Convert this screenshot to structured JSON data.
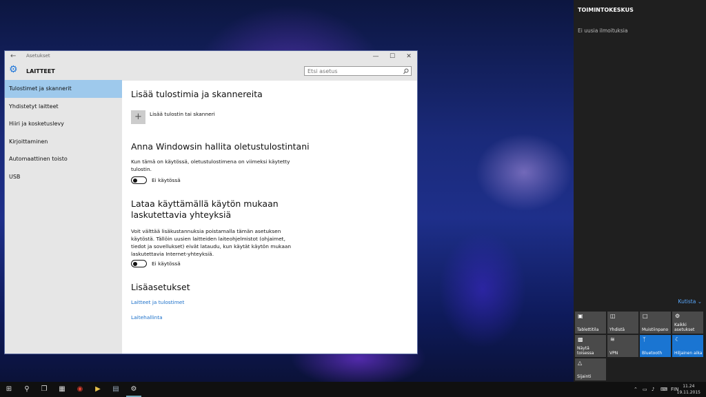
{
  "window": {
    "title": "Asetukset",
    "back_icon": "back-arrow-icon",
    "minimize": "—",
    "maximize": "☐",
    "close": "✕",
    "section_title": "LAITTEET",
    "search_placeholder": "Etsi asetus"
  },
  "sidebar": {
    "items": [
      {
        "label": "Tulostimet ja skannerit",
        "active": true
      },
      {
        "label": "Yhdistetyt laitteet"
      },
      {
        "label": "Hiiri ja kosketuslevy"
      },
      {
        "label": "Kirjoittaminen"
      },
      {
        "label": "Automaattinen toisto"
      },
      {
        "label": "USB"
      }
    ]
  },
  "content": {
    "add_heading": "Lisää tulostimia ja skannereita",
    "add_button": "Lisää tulostin tai skanneri",
    "default_heading": "Anna Windowsin hallita oletustulostintani",
    "default_desc": "Kun tämä on käytössä, oletustulostimena on viimeksi käytetty tulostin.",
    "default_toggle": "Ei käytössä",
    "metered_heading": "Lataa käyttämällä käytön mukaan laskutettavia yhteyksiä",
    "metered_desc": "Voit välttää lisäkustannuksia poistamalla tämän asetuksen käytöstä. Tällöin uusien laitteiden laiteohjelmistot (ohjaimet, tiedot ja sovellukset) eivät lataudu, kun käytät käytön mukaan laskutettavia Internet-yhteyksiä.",
    "metered_toggle": "Ei käytössä",
    "more_heading": "Lisäasetukset",
    "link1": "Laitteet ja tulostimet",
    "link2": "Laitehallinta"
  },
  "action_center": {
    "title": "TOIMINTOKESKUS",
    "no_notifications": "Ei uusia ilmoituksia",
    "collapse": "Kutista",
    "tiles": [
      {
        "label": "Tablettitila",
        "on": false
      },
      {
        "label": "Yhdistä",
        "on": false
      },
      {
        "label": "Muistiinpano",
        "on": false
      },
      {
        "label": "Kaikki asetukset",
        "on": false
      },
      {
        "label": "Näytä toisessa",
        "on": false
      },
      {
        "label": "VPN",
        "on": false
      },
      {
        "label": "Bluetooth",
        "on": true
      },
      {
        "label": "Hiljainen aika",
        "on": true
      },
      {
        "label": "Sijainti",
        "on": false
      }
    ]
  },
  "taskbar": {
    "language": "FIN",
    "time": "11.24",
    "date": "19.11.2015"
  },
  "colors": {
    "accent": "#1a75d2",
    "selected_nav": "#9ec9ec",
    "link": "#1a6fc9"
  }
}
